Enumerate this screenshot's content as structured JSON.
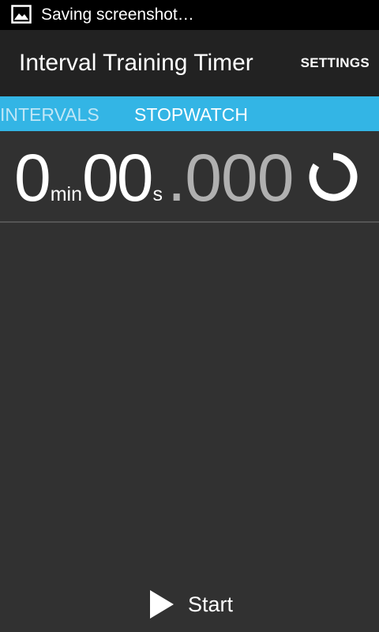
{
  "status_bar": {
    "notification_text": "Saving screenshot…",
    "notification_icon": "image-icon"
  },
  "action_bar": {
    "title": "Interval Training Timer",
    "settings_label": "SETTINGS"
  },
  "tabs": [
    {
      "label": "INTERVALS",
      "selected": false
    },
    {
      "label": "STOPWATCH",
      "selected": true
    }
  ],
  "timer": {
    "minutes": "0",
    "minutes_unit": "min",
    "seconds": "00",
    "seconds_unit": "s",
    "separator": ".",
    "milliseconds": "000"
  },
  "controls": {
    "start_label": "Start",
    "start_icon": "play-icon"
  },
  "colors": {
    "tab_strip": "#33b5e5",
    "background": "#313131",
    "action_bar": "#222222",
    "status_bar": "#000000"
  }
}
